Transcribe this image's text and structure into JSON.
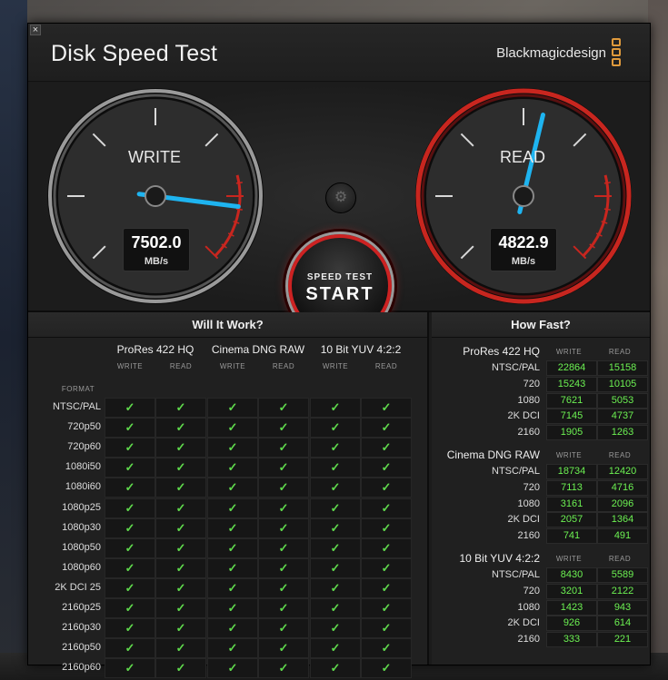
{
  "app": {
    "title": "Disk Speed Test",
    "brand": "Blackmagicdesign",
    "close_label": "×"
  },
  "gauges": {
    "write": {
      "label": "WRITE",
      "value": "7502.0",
      "unit": "MB/s",
      "fraction": 0.86
    },
    "read": {
      "label": "READ",
      "value": "4822.9",
      "unit": "MB/s",
      "fraction": 0.55
    },
    "needle_color": "#1eb4f0",
    "accent_red": "#c8261f"
  },
  "start_button": {
    "small": "SPEED TEST",
    "big": "START"
  },
  "settings_icon": "gear-icon",
  "will_it_work": {
    "title": "Will It Work?",
    "format_header": "FORMAT",
    "codecs": [
      "ProRes 422 HQ",
      "Cinema DNG RAW",
      "10 Bit YUV 4:2:2"
    ],
    "sub": [
      "WRITE",
      "READ"
    ],
    "check": "✓",
    "formats": [
      "NTSC/PAL",
      "720p50",
      "720p60",
      "1080i50",
      "1080i60",
      "1080p25",
      "1080p30",
      "1080p50",
      "1080p60",
      "2K DCI 25",
      "2160p25",
      "2160p30",
      "2160p50",
      "2160p60"
    ]
  },
  "how_fast": {
    "title": "How Fast?",
    "sub": [
      "WRITE",
      "READ"
    ],
    "groups": [
      {
        "name": "ProRes 422 HQ",
        "rows": [
          {
            "label": "NTSC/PAL",
            "write": "22864",
            "read": "15158"
          },
          {
            "label": "720",
            "write": "15243",
            "read": "10105"
          },
          {
            "label": "1080",
            "write": "7621",
            "read": "5053"
          },
          {
            "label": "2K DCI",
            "write": "7145",
            "read": "4737"
          },
          {
            "label": "2160",
            "write": "1905",
            "read": "1263"
          }
        ]
      },
      {
        "name": "Cinema DNG RAW",
        "rows": [
          {
            "label": "NTSC/PAL",
            "write": "18734",
            "read": "12420"
          },
          {
            "label": "720",
            "write": "7113",
            "read": "4716"
          },
          {
            "label": "1080",
            "write": "3161",
            "read": "2096"
          },
          {
            "label": "2K DCI",
            "write": "2057",
            "read": "1364"
          },
          {
            "label": "2160",
            "write": "741",
            "read": "491"
          }
        ]
      },
      {
        "name": "10 Bit YUV 4:2:2",
        "rows": [
          {
            "label": "NTSC/PAL",
            "write": "8430",
            "read": "5589"
          },
          {
            "label": "720",
            "write": "3201",
            "read": "2122"
          },
          {
            "label": "1080",
            "write": "1423",
            "read": "943"
          },
          {
            "label": "2K DCI",
            "write": "926",
            "read": "614"
          },
          {
            "label": "2160",
            "write": "333",
            "read": "221"
          }
        ]
      }
    ]
  }
}
